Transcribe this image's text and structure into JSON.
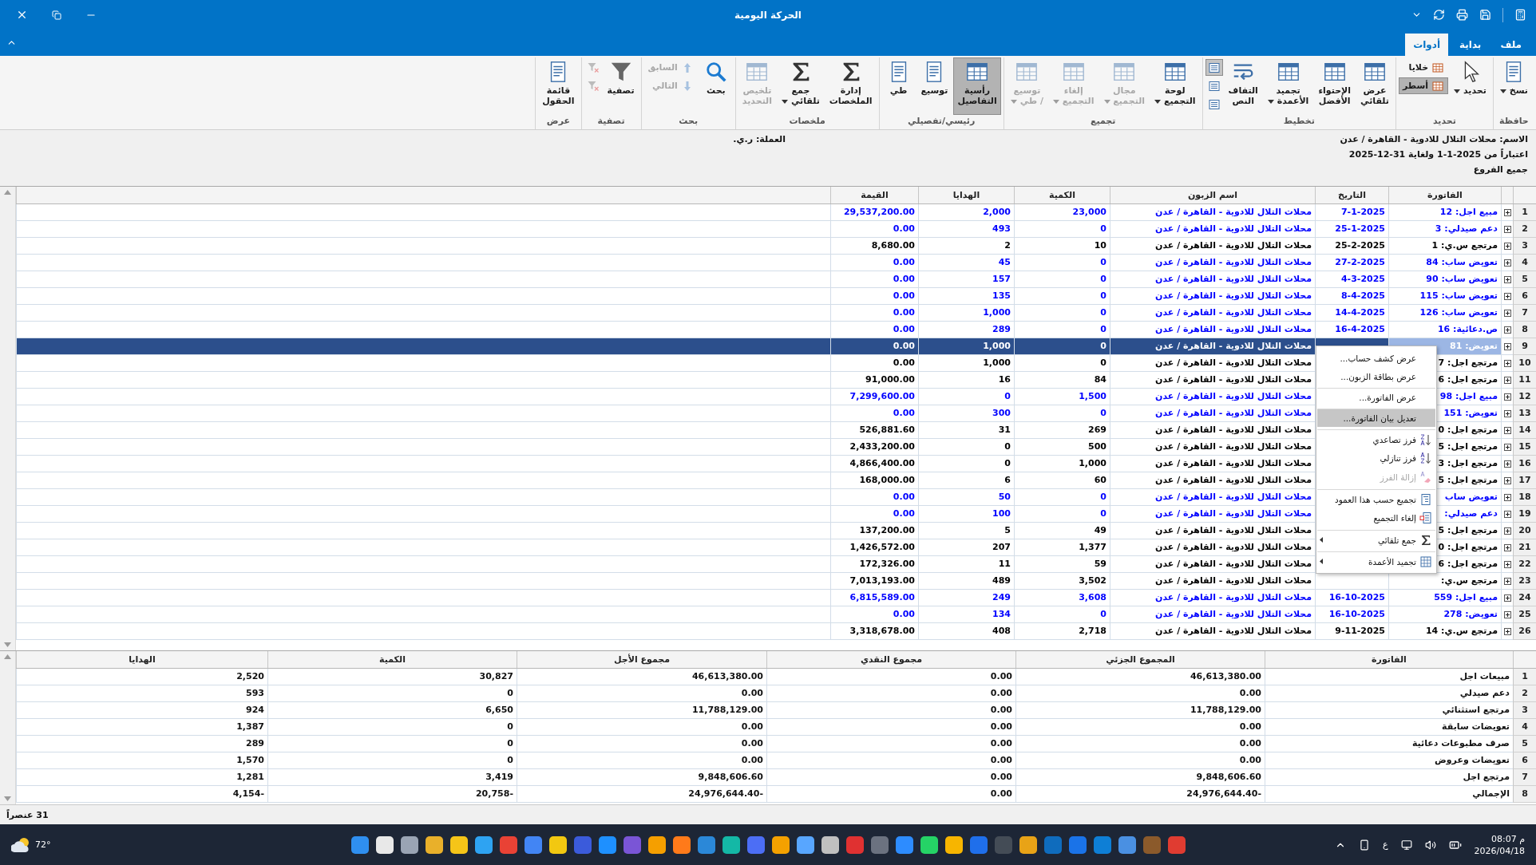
{
  "window": {
    "title": "الحركة اليومية"
  },
  "tabs": [
    {
      "label": "ملف",
      "selected": false
    },
    {
      "label": "بداية",
      "selected": false
    },
    {
      "label": "أدوات",
      "selected": true
    }
  ],
  "ribbon": [
    {
      "label": "حافظة",
      "buttons": [
        {
          "kind": "large",
          "label": "نسخ",
          "dropdown": true,
          "disabled": false,
          "selected": false
        }
      ]
    },
    {
      "label": "تحديد",
      "buttons": [
        {
          "kind": "large",
          "label": "تحديد",
          "dropdown": true,
          "disabled": false,
          "selected": false
        },
        {
          "kind": "small",
          "label": "خلايا",
          "dropdown": false,
          "disabled": false,
          "selected": false
        },
        {
          "kind": "small",
          "label": "أسطر",
          "dropdown": false,
          "disabled": false,
          "selected": true
        }
      ]
    },
    {
      "label": "تخطيط",
      "buttons": [
        {
          "kind": "large",
          "label": "عرض\nتلقائي",
          "dropdown": false,
          "disabled": false,
          "selected": false
        },
        {
          "kind": "large",
          "label": "الإحتواء\nالأفضل",
          "dropdown": false,
          "disabled": false,
          "selected": false
        },
        {
          "kind": "large",
          "label": "تجميد\nالأعمدة",
          "dropdown": true,
          "disabled": false,
          "selected": false
        },
        {
          "kind": "large",
          "label": "التفاف\nالنص",
          "dropdown": false,
          "disabled": false,
          "selected": false
        },
        {
          "kind": "icon",
          "dropdown": false,
          "disabled": false,
          "selected": true
        },
        {
          "kind": "icon",
          "dropdown": false,
          "disabled": false,
          "selected": false
        },
        {
          "kind": "icon",
          "dropdown": false,
          "disabled": false,
          "selected": false
        }
      ]
    },
    {
      "label": "تجميع",
      "buttons": [
        {
          "kind": "large",
          "label": "لوحة\nالتجميع",
          "dropdown": true,
          "disabled": false,
          "selected": false
        },
        {
          "kind": "large",
          "label": "مجال\nالتجميع",
          "dropdown": true,
          "disabled": true,
          "selected": false
        },
        {
          "kind": "large",
          "label": "إلغاء\nالتجميع",
          "dropdown": true,
          "disabled": true,
          "selected": false
        },
        {
          "kind": "large",
          "label": "توسيع\n/ طي",
          "dropdown": true,
          "disabled": true,
          "selected": false
        }
      ]
    },
    {
      "label": "رئيسي/تفصيلي",
      "buttons": [
        {
          "kind": "large",
          "label": "رأسية\nالتفاصيل",
          "dropdown": false,
          "disabled": false,
          "selected": true
        },
        {
          "kind": "large",
          "label": "توسيع",
          "dropdown": false,
          "disabled": false,
          "selected": false
        },
        {
          "kind": "large",
          "label": "طي",
          "dropdown": false,
          "disabled": false,
          "selected": false
        }
      ]
    },
    {
      "label": "ملخصات",
      "buttons": [
        {
          "kind": "large",
          "label": "إدارة\nالملخصات",
          "dropdown": false,
          "disabled": false,
          "selected": false
        },
        {
          "kind": "large",
          "label": "جمع\nتلقائي",
          "dropdown": true,
          "disabled": false,
          "selected": false
        },
        {
          "kind": "large",
          "label": "تلخيص\nالتحديد",
          "dropdown": false,
          "disabled": true,
          "selected": false
        }
      ]
    },
    {
      "label": "بحث",
      "buttons": [
        {
          "kind": "large",
          "label": "بحث",
          "dropdown": false,
          "disabled": false,
          "selected": false
        },
        {
          "kind": "small",
          "label": "السابق",
          "dropdown": false,
          "disabled": true,
          "selected": false
        },
        {
          "kind": "small",
          "label": "التالي",
          "dropdown": false,
          "disabled": true,
          "selected": false
        }
      ]
    },
    {
      "label": "تصفية",
      "buttons": [
        {
          "kind": "large",
          "label": "تصفية",
          "dropdown": false,
          "disabled": false,
          "selected": false
        },
        {
          "kind": "icon",
          "dropdown": false,
          "disabled": true,
          "selected": false
        },
        {
          "kind": "icon",
          "dropdown": false,
          "disabled": true,
          "selected": false
        }
      ]
    },
    {
      "label": "عرض",
      "buttons": [
        {
          "kind": "large",
          "label": "قائمة\nالحقول",
          "dropdown": false,
          "disabled": false,
          "selected": false
        }
      ]
    }
  ],
  "info": {
    "name": "الاسم: محلات التلال للادوية - القاهرة / عدن",
    "period": "اعتباراً من  2025-1-1 ولغاية  31-12-2025",
    "branches": "جميع الفروع",
    "currency": "العملة: ر.ي."
  },
  "table": {
    "columns": [
      "الفاتورة",
      "التاريخ",
      "اسم الزبون",
      "الكمية",
      "الهدايا",
      "القيمة"
    ],
    "rows": [
      {
        "number": "1",
        "invoice": "مبيع اجل: 12",
        "date": "7-1-2025",
        "customer": "محلات التلال للادوية - القاهرة / عدن",
        "quantity": "23,000",
        "gifts": "2,000",
        "value": "29,537,200.00",
        "color": "#0000ff",
        "selected": false
      },
      {
        "number": "2",
        "invoice": "دعم صيدلي: 3",
        "date": "25-1-2025",
        "customer": "محلات التلال للادوية - القاهرة / عدن",
        "quantity": "0",
        "gifts": "493",
        "value": "0.00",
        "color": "#0000ff",
        "selected": false
      },
      {
        "number": "3",
        "invoice": "مرتجع س.ي: 1",
        "date": "25-2-2025",
        "customer": "محلات التلال للادوية - القاهرة / عدن",
        "quantity": "10",
        "gifts": "2",
        "value": "8,680.00",
        "color": "#000000",
        "selected": false
      },
      {
        "number": "4",
        "invoice": "تعويض ساب: 84",
        "date": "27-2-2025",
        "customer": "محلات التلال للادوية - القاهرة / عدن",
        "quantity": "0",
        "gifts": "45",
        "value": "0.00",
        "color": "#0000ff",
        "selected": false
      },
      {
        "number": "5",
        "invoice": "تعويض ساب: 90",
        "date": "4-3-2025",
        "customer": "محلات التلال للادوية - القاهرة / عدن",
        "quantity": "0",
        "gifts": "157",
        "value": "0.00",
        "color": "#0000ff",
        "selected": false
      },
      {
        "number": "6",
        "invoice": "تعويض ساب: 115",
        "date": "8-4-2025",
        "customer": "محلات التلال للادوية - القاهرة / عدن",
        "quantity": "0",
        "gifts": "135",
        "value": "0.00",
        "color": "#0000ff",
        "selected": false
      },
      {
        "number": "7",
        "invoice": "تعويض ساب: 126",
        "date": "14-4-2025",
        "customer": "محلات التلال للادوية - القاهرة / عدن",
        "quantity": "0",
        "gifts": "1,000",
        "value": "0.00",
        "color": "#0000ff",
        "selected": false
      },
      {
        "number": "8",
        "invoice": "ص.دعائية: 16",
        "date": "16-4-2025",
        "customer": "محلات التلال للادوية - القاهرة / عدن",
        "quantity": "0",
        "gifts": "289",
        "value": "0.00",
        "color": "#0000ff",
        "selected": false
      },
      {
        "number": "9",
        "invoice": "تعويض: 81",
        "customer": "محلات التلال للادوية - القاهرة / عدن",
        "quantity": "0",
        "gifts": "1,000",
        "value": "0.00",
        "selected": true
      },
      {
        "number": "10",
        "invoice": "مرتجع اجل: 7",
        "customer": "محلات التلال للادوية - القاهرة / عدن",
        "quantity": "0",
        "gifts": "1,000",
        "value": "0.00",
        "color": "#000000",
        "selected": false
      },
      {
        "number": "11",
        "invoice": "مرتجع اجل: 6",
        "customer": "محلات التلال للادوية - القاهرة / عدن",
        "quantity": "84",
        "gifts": "16",
        "value": "91,000.00",
        "color": "#000000",
        "selected": false
      },
      {
        "number": "12",
        "invoice": "مبيع اجل: 98",
        "customer": "محلات التلال للادوية - القاهرة / عدن",
        "quantity": "1,500",
        "gifts": "0",
        "value": "7,299,600.00",
        "color": "#0000ff",
        "selected": false
      },
      {
        "number": "13",
        "invoice": "تعويض: 151",
        "customer": "محلات التلال للادوية - القاهرة / عدن",
        "quantity": "0",
        "gifts": "300",
        "value": "0.00",
        "color": "#0000ff",
        "selected": false
      },
      {
        "number": "14",
        "invoice": "مرتجع اجل: 0",
        "customer": "محلات التلال للادوية - القاهرة / عدن",
        "quantity": "269",
        "gifts": "31",
        "value": "526,881.60",
        "color": "#000000",
        "selected": false
      },
      {
        "number": "15",
        "invoice": "مرتجع اجل: 5",
        "customer": "محلات التلال للادوية - القاهرة / عدن",
        "quantity": "500",
        "gifts": "0",
        "value": "2,433,200.00",
        "color": "#000000",
        "selected": false
      },
      {
        "number": "16",
        "invoice": "مرتجع اجل: 3",
        "customer": "محلات التلال للادوية - القاهرة / عدن",
        "quantity": "1,000",
        "gifts": "0",
        "value": "4,866,400.00",
        "color": "#000000",
        "selected": false
      },
      {
        "number": "17",
        "invoice": "مرتجع اجل: 5",
        "customer": "محلات التلال للادوية - القاهرة / عدن",
        "quantity": "60",
        "gifts": "6",
        "value": "168,000.00",
        "color": "#000000",
        "selected": false
      },
      {
        "number": "18",
        "invoice": "تعويض ساب",
        "customer": "محلات التلال للادوية - القاهرة / عدن",
        "quantity": "0",
        "gifts": "50",
        "value": "0.00",
        "color": "#0000ff",
        "selected": false
      },
      {
        "number": "19",
        "invoice": "دعم صيدلي:",
        "customer": "محلات التلال للادوية - القاهرة / عدن",
        "quantity": "0",
        "gifts": "100",
        "value": "0.00",
        "color": "#0000ff",
        "selected": false
      },
      {
        "number": "20",
        "invoice": "مرتجع اجل: 5",
        "customer": "محلات التلال للادوية - القاهرة / عدن",
        "quantity": "49",
        "gifts": "5",
        "value": "137,200.00",
        "color": "#000000",
        "selected": false
      },
      {
        "number": "21",
        "invoice": "مرتجع اجل: 0",
        "customer": "محلات التلال للادوية - القاهرة / عدن",
        "quantity": "1,377",
        "gifts": "207",
        "value": "1,426,572.00",
        "color": "#000000",
        "selected": false
      },
      {
        "number": "22",
        "invoice": "مرتجع اجل: 6",
        "customer": "محلات التلال للادوية - القاهرة / عدن",
        "quantity": "59",
        "gifts": "11",
        "value": "172,326.00",
        "color": "#000000",
        "selected": false
      },
      {
        "number": "23",
        "invoice": "مرتجع س.ي:",
        "customer": "محلات التلال للادوية - القاهرة / عدن",
        "quantity": "3,502",
        "gifts": "489",
        "value": "7,013,193.00",
        "color": "#000000",
        "selected": false
      },
      {
        "number": "24",
        "invoice": "مبيع اجل: 559",
        "date": "16-10-2025",
        "customer": "محلات التلال للادوية - القاهرة / عدن",
        "quantity": "3,608",
        "gifts": "249",
        "value": "6,815,589.00",
        "color": "#0000ff",
        "selected": false
      },
      {
        "number": "25",
        "invoice": "تعويض: 278",
        "date": "16-10-2025",
        "customer": "محلات التلال للادوية - القاهرة / عدن",
        "quantity": "0",
        "gifts": "134",
        "value": "0.00",
        "color": "#0000ff",
        "selected": false
      },
      {
        "number": "26",
        "invoice": "مرتجع س.ي: 14",
        "date": "9-11-2025",
        "customer": "محلات التلال للادوية - القاهرة / عدن",
        "quantity": "2,718",
        "gifts": "408",
        "value": "3,318,678.00",
        "color": "#000000",
        "selected": false
      }
    ]
  },
  "context_menu": [
    {
      "label": "عرض كشف حساب...",
      "kind": "plain",
      "separator_before": false,
      "highlighted": false,
      "disabled": false,
      "submenu": false
    },
    {
      "label": "عرض بطاقة الزبون...",
      "kind": "plain",
      "separator_before": false,
      "highlighted": false,
      "disabled": false,
      "submenu": false
    },
    {
      "label": "عرض الفاتورة...",
      "kind": "plain",
      "separator_before": true,
      "highlighted": false,
      "disabled": false,
      "submenu": false
    },
    {
      "label": "تعديل بيان الفاتورة...",
      "kind": "plain",
      "separator_before": true,
      "highlighted": true,
      "disabled": false,
      "submenu": false
    },
    {
      "label": "فرز تصاعدي",
      "kind": "sort-ascending",
      "separator_before": true,
      "highlighted": false,
      "disabled": false,
      "submenu": false
    },
    {
      "label": "فرز تنازلي",
      "kind": "sort-descending",
      "separator_before": false,
      "highlighted": false,
      "disabled": false,
      "submenu": false
    },
    {
      "label": "إزالة الفرز",
      "kind": "clear-sort",
      "separator_before": false,
      "highlighted": false,
      "disabled": true,
      "submenu": false
    },
    {
      "label": "تجميع حسب هذا العمود",
      "kind": "group",
      "separator_before": true,
      "highlighted": false,
      "disabled": false,
      "submenu": false
    },
    {
      "label": "إلغاء التجميع",
      "kind": "ungroup",
      "separator_before": false,
      "highlighted": false,
      "disabled": false,
      "submenu": false
    },
    {
      "label": "جمع تلقائي",
      "kind": "sum",
      "separator_before": true,
      "highlighted": false,
      "disabled": false,
      "submenu": true
    },
    {
      "label": "تجميد الأعمدة",
      "kind": "freeze",
      "separator_before": true,
      "highlighted": false,
      "disabled": false,
      "submenu": true
    }
  ],
  "summary": {
    "columns": [
      "الفاتورة",
      "المجموع الجزئي",
      "مجموع النقدي",
      "مجموع الأجل",
      "الكمية",
      "الهدايا"
    ],
    "rows": [
      {
        "number": "1",
        "cells": [
          "مبيعات اجل",
          "46,613,380.00",
          "0.00",
          "46,613,380.00",
          "30,827",
          "2,520"
        ]
      },
      {
        "number": "2",
        "cells": [
          "دعم صيدلي",
          "0.00",
          "0.00",
          "0.00",
          "0",
          "593"
        ]
      },
      {
        "number": "3",
        "cells": [
          "مرتجع استثنائي",
          "11,788,129.00",
          "0.00",
          "11,788,129.00",
          "6,650",
          "924"
        ]
      },
      {
        "number": "4",
        "cells": [
          "تعويضات سابقة",
          "0.00",
          "0.00",
          "0.00",
          "0",
          "1,387"
        ]
      },
      {
        "number": "5",
        "cells": [
          "صرف مطبوعات دعائية",
          "0.00",
          "0.00",
          "0.00",
          "0",
          "289"
        ]
      },
      {
        "number": "6",
        "cells": [
          "تعويضات وعروض",
          "0.00",
          "0.00",
          "0.00",
          "0",
          "1,570"
        ]
      },
      {
        "number": "7",
        "cells": [
          "مرتجع اجل",
          "9,848,606.60",
          "0.00",
          "9,848,606.60",
          "3,419",
          "1,281"
        ]
      },
      {
        "number": "8",
        "cells": [
          "الإجمالي",
          "-24,976,644.40",
          "0.00",
          "-24,976,644.40",
          "-20,758",
          "-4,154"
        ]
      }
    ]
  },
  "status_bar": "31 عنصراً",
  "taskbar": {
    "weather": "72°",
    "language": "ع",
    "time": "08:07 م",
    "date": "2026/04/18"
  }
}
